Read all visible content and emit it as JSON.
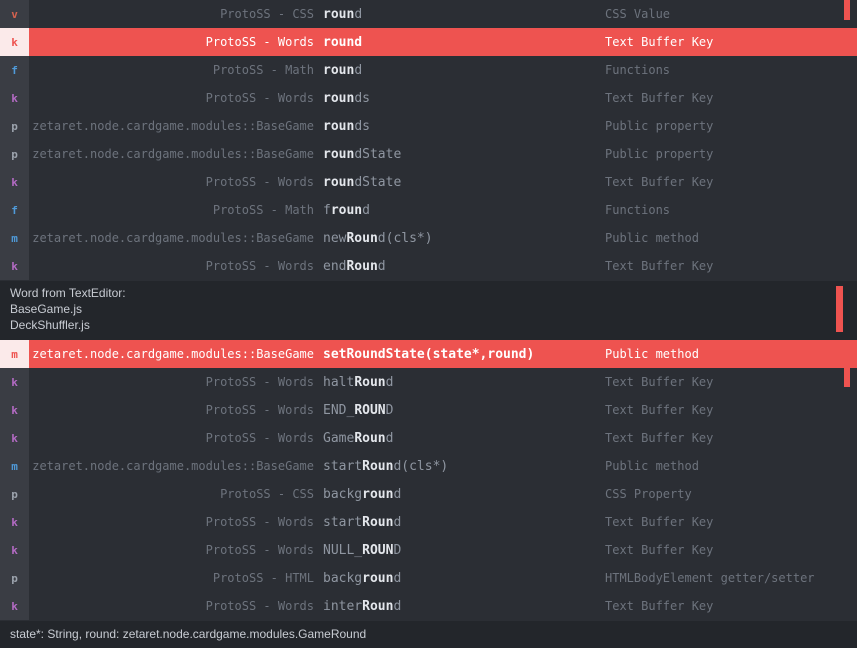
{
  "colors": {
    "v": "#d4624f",
    "k": "#b36bc4",
    "f": "#4f9ad9",
    "p": "#9ca3ad",
    "m": "#4f9ad9",
    "accent": "#ee5350"
  },
  "list1": [
    {
      "kind": "v",
      "provider": "ProtoSS - CSS",
      "pre": "",
      "match": "roun",
      "post": "d",
      "type": "CSS Value",
      "selected": false
    },
    {
      "kind": "k",
      "provider": "ProtoSS - Words",
      "pre": "",
      "match": "round",
      "post": "",
      "type": "Text Buffer Key",
      "selected": true
    },
    {
      "kind": "f",
      "provider": "ProtoSS - Math",
      "pre": "",
      "match": "roun",
      "post": "d",
      "type": "Functions",
      "selected": false
    },
    {
      "kind": "k",
      "provider": "ProtoSS - Words",
      "pre": "",
      "match": "roun",
      "post": "ds",
      "type": "Text Buffer Key",
      "selected": false
    },
    {
      "kind": "p",
      "provider": "zetaret.node.cardgame.modules::BaseGame",
      "pre": "",
      "match": "roun",
      "post": "ds",
      "type": "Public property",
      "selected": false
    },
    {
      "kind": "p",
      "provider": "zetaret.node.cardgame.modules::BaseGame",
      "pre": "",
      "match": "roun",
      "post": "dState",
      "type": "Public property",
      "selected": false
    },
    {
      "kind": "k",
      "provider": "ProtoSS - Words",
      "pre": "",
      "match": "roun",
      "post": "dState",
      "type": "Text Buffer Key",
      "selected": false
    },
    {
      "kind": "f",
      "provider": "ProtoSS - Math",
      "pre": "f",
      "match": "roun",
      "post": "d",
      "type": "Functions",
      "selected": false
    },
    {
      "kind": "m",
      "provider": "zetaret.node.cardgame.modules::BaseGame",
      "pre": "new",
      "match": "Roun",
      "post": "d(cls*)",
      "type": "Public method",
      "selected": false
    },
    {
      "kind": "k",
      "provider": "ProtoSS - Words",
      "pre": "end",
      "match": "Roun",
      "post": "d",
      "type": "Text Buffer Key",
      "selected": false
    }
  ],
  "doc": {
    "line1": "Word from TextEditor:",
    "line2": "BaseGame.js",
    "line3": "DeckShuffler.js"
  },
  "list2": [
    {
      "kind": "m",
      "provider": "zetaret.node.cardgame.modules::BaseGame",
      "pre": "set",
      "match": "Roun",
      "post": "dState(state*,round)",
      "type": "Public method",
      "selected": true
    },
    {
      "kind": "k",
      "provider": "ProtoSS - Words",
      "pre": "halt",
      "match": "Roun",
      "post": "d",
      "type": "Text Buffer Key",
      "selected": false
    },
    {
      "kind": "k",
      "provider": "ProtoSS - Words",
      "pre": "END_",
      "match": "ROUN",
      "post": "D",
      "type": "Text Buffer Key",
      "selected": false
    },
    {
      "kind": "k",
      "provider": "ProtoSS - Words",
      "pre": "Game",
      "match": "Roun",
      "post": "d",
      "type": "Text Buffer Key",
      "selected": false
    },
    {
      "kind": "m",
      "provider": "zetaret.node.cardgame.modules::BaseGame",
      "pre": "start",
      "match": "Roun",
      "post": "d(cls*)",
      "type": "Public method",
      "selected": false
    },
    {
      "kind": "p",
      "provider": "ProtoSS - CSS",
      "pre": "backg",
      "match": "roun",
      "post": "d",
      "type": "CSS Property",
      "selected": false
    },
    {
      "kind": "k",
      "provider": "ProtoSS - Words",
      "pre": "start",
      "match": "Roun",
      "post": "d",
      "type": "Text Buffer Key",
      "selected": false
    },
    {
      "kind": "k",
      "provider": "ProtoSS - Words",
      "pre": "NULL_",
      "match": "ROUN",
      "post": "D",
      "type": "Text Buffer Key",
      "selected": false
    },
    {
      "kind": "p",
      "provider": "ProtoSS - HTML",
      "pre": "backg",
      "match": "roun",
      "post": "d",
      "type": "HTMLBodyElement getter/setter",
      "selected": false
    },
    {
      "kind": "k",
      "provider": "ProtoSS - Words",
      "pre": "inter",
      "match": "Roun",
      "post": "d",
      "type": "Text Buffer Key",
      "selected": false
    }
  ],
  "footer": {
    "signature": "state*: String, round: zetaret.node.cardgame.modules.GameRound"
  }
}
